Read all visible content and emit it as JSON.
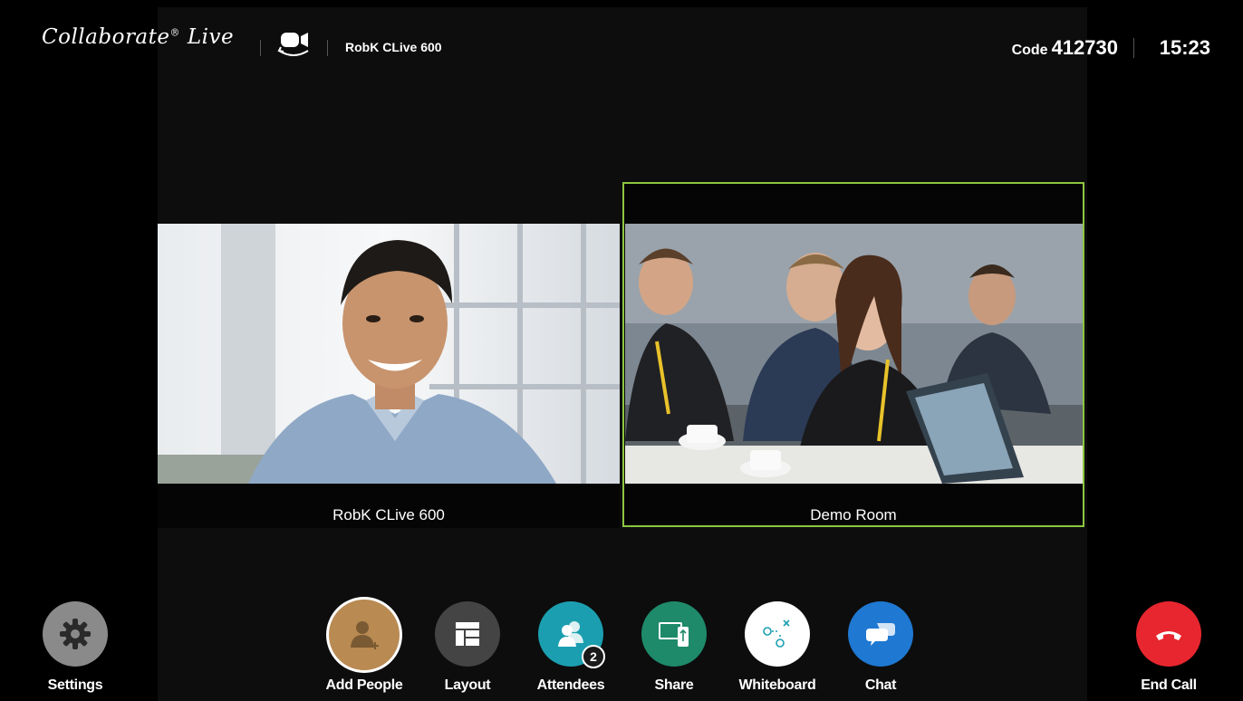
{
  "header": {
    "brand": "Collaborate",
    "brand_mark": "®",
    "brand_suffix": "Live",
    "device_name": "RobK CLive 600",
    "code_label": "Code",
    "code_value": "412730",
    "time": "15:23"
  },
  "tiles": [
    {
      "name": "RobK CLive 600",
      "active": false
    },
    {
      "name": "Demo Room",
      "active": true
    }
  ],
  "toolbar": {
    "settings": "Settings",
    "add_people": "Add People",
    "layout": "Layout",
    "attendees": "Attendees",
    "attendees_count": "2",
    "share": "Share",
    "whiteboard": "Whiteboard",
    "chat": "Chat",
    "end_call": "End Call"
  },
  "colors": {
    "active_border": "#8cc63f",
    "settings": "#8a8a8a",
    "add_people": "#b98a52",
    "layout": "#444444",
    "attendees": "#1b9fb0",
    "share": "#1e8a6a",
    "whiteboard": "#ffffff",
    "chat": "#1f78d1",
    "end_call": "#e8262f"
  }
}
